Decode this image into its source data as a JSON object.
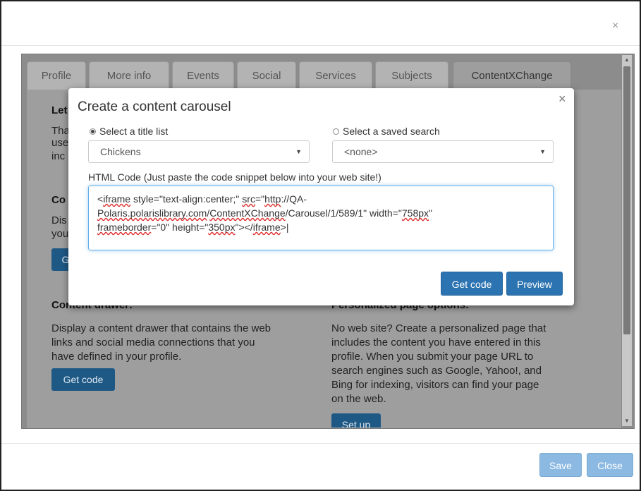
{
  "dialog": {
    "close_icon": "×"
  },
  "tabs": [
    {
      "label": "Profile",
      "active": false
    },
    {
      "label": "More info",
      "active": false
    },
    {
      "label": "Events",
      "active": false
    },
    {
      "label": "Social",
      "active": false
    },
    {
      "label": "Services",
      "active": false
    },
    {
      "label": "Subjects",
      "active": false
    },
    {
      "label": "ContentXChange",
      "active": true
    }
  ],
  "background": {
    "partial_heading_1": "Let",
    "partial_lines_1": [
      "Tha",
      "use",
      "inc"
    ],
    "partial_heading_2": "Co",
    "partial_lines_2": [
      "Dis",
      "you"
    ],
    "partial_btn": "G",
    "drawer_heading": "Content drawer:",
    "drawer_text": [
      "Display a content drawer that contains the web",
      "links and social media connections that you",
      "have defined in your profile."
    ],
    "drawer_button": "Get code",
    "personalized_heading": "Personalized page options:",
    "personalized_text": [
      "No web site? Create a personalized page that",
      "includes the content you have entered in this",
      "profile. When you submit your page URL to",
      "search engines such as Google, Yahoo!, and",
      "Bing for indexing, visitors can find your page",
      "on the web."
    ],
    "personalized_button": "Set up"
  },
  "modal": {
    "title": "Create a content carousel",
    "close_icon": "×",
    "radio_title_list": "Select a title list",
    "radio_saved_search": "Select a saved search",
    "title_list_value": "Chickens",
    "saved_search_value": "<none>",
    "html_code_label": "HTML Code (Just paste the code snippet below into your web site!)",
    "code": {
      "p1": "<",
      "w_iframe": "iframe",
      "p2": " style=\"text-align:center;\" ",
      "w_src": "src",
      "p3": "=\"",
      "w_http": "http",
      "p4": "://QA-",
      "w_polaris": "Polaris.polarislibrary.com",
      "p5": "/",
      "w_cx": "ContentXChange",
      "p6": "/Carousel/1/589/1\" width=\"",
      "w_758": "758px",
      "p7": "\"",
      "w_frameborder": "frameborder",
      "p8": "=\"0\" height=\"",
      "w_350": "350px",
      "p9": "\"></",
      "w_iframe2": "iframe",
      "p10": ">"
    },
    "get_code_button": "Get code",
    "preview_button": "Preview"
  },
  "footer": {
    "save_button": "Save",
    "close_button": "Close"
  },
  "scrollbar": {
    "up_icon": "▲",
    "down_icon": "▼"
  },
  "colors": {
    "primary_button": "#2b73b1",
    "disabled_button": "#8bb9e1",
    "overlay": "#9e9e9e"
  }
}
